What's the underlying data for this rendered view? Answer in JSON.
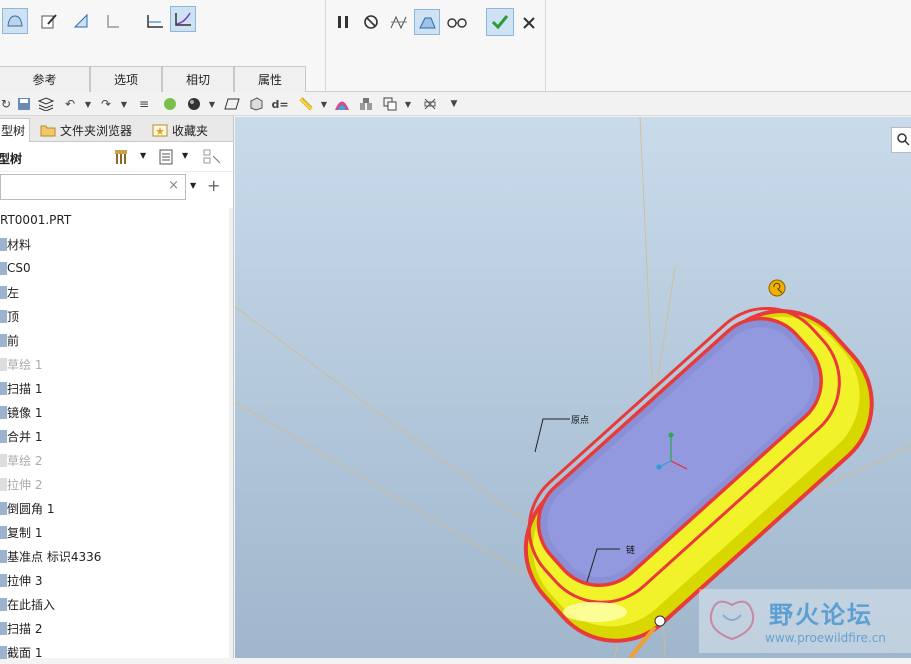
{
  "ribbon": {
    "tabs": [
      "参考",
      "选项",
      "相切",
      "属性"
    ]
  },
  "panel": {
    "tabs": [
      "型树",
      "文件夹浏览器",
      "收藏夹"
    ],
    "header_label": "型树",
    "search_value": ""
  },
  "tree": [
    {
      "label": "RT0001.PRT",
      "dim": false
    },
    {
      "label": "材料",
      "dim": false
    },
    {
      "label": "CS0",
      "dim": false
    },
    {
      "label": "左",
      "dim": false
    },
    {
      "label": "顶",
      "dim": false
    },
    {
      "label": "前",
      "dim": false
    },
    {
      "label": "草绘 1",
      "dim": true
    },
    {
      "label": "扫描 1",
      "dim": false
    },
    {
      "label": "镜像 1",
      "dim": false
    },
    {
      "label": "合并 1",
      "dim": false
    },
    {
      "label": "草绘 2",
      "dim": true
    },
    {
      "label": "拉伸 2",
      "dim": true
    },
    {
      "label": "倒圆角 1",
      "dim": false
    },
    {
      "label": "复制 1",
      "dim": false
    },
    {
      "label": "基准点 标识4336",
      "dim": false
    },
    {
      "label": "拉伸 3",
      "dim": false
    },
    {
      "label": "在此插入",
      "dim": false
    },
    {
      "label": "扫描 2",
      "dim": false
    },
    {
      "label": "截面 1",
      "dim": false
    }
  ],
  "viewport": {
    "label_origin": "原点",
    "label_chain": "链",
    "watermark_cn": "野火论坛",
    "watermark_url": "www.proewildfire.cn"
  },
  "colors": {
    "accent": "#2b9a3a",
    "sweep_yellow": "#e6e600",
    "highlight_red": "#e83a3a",
    "surface_purple": "#8a8fd6"
  }
}
